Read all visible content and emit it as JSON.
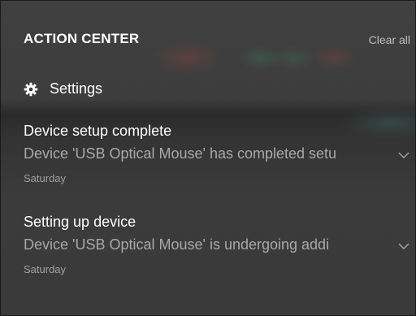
{
  "action_center": {
    "title": "ACTION CENTER",
    "clear_all_label": "Clear all",
    "settings": {
      "icon": "gear-icon",
      "label": "Settings"
    },
    "notifications": [
      {
        "title": "Device setup complete",
        "body": "Device 'USB Optical Mouse' has completed setu",
        "time": "Saturday",
        "expand_icon": "chevron-down-icon"
      },
      {
        "title": "Setting up device",
        "body": "Device 'USB Optical Mouse' is undergoing addi",
        "time": "Saturday",
        "expand_icon": "chevron-down-icon"
      }
    ]
  },
  "colors": {
    "panel_bg": "#3a3a3a",
    "primary_text": "#ffffff",
    "secondary_text": "#a8a8a8",
    "link_text": "#bdbdbd"
  }
}
